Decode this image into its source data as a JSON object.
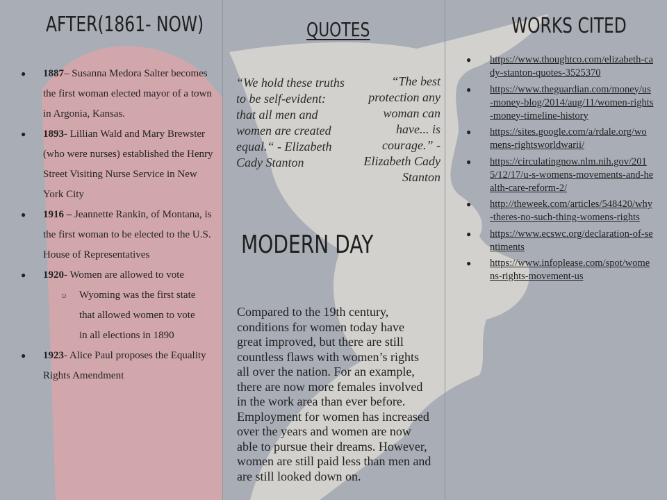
{
  "after": {
    "heading": "AFTER(1861- NOW)",
    "events": [
      {
        "year": "1887",
        "text": "– Susanna Medora Salter becomes the first woman elected mayor of a town in Argonia, Kansas."
      },
      {
        "year": "1893",
        "text": "- Lillian Wald and Mary Brewster (who were nurses) established the Henry Street Visiting Nurse Service in New York City"
      },
      {
        "year": "1916 –",
        "text": " Jeannette Rankin, of Montana, is the first woman to be elected to the U.S. House of Representatives"
      },
      {
        "year": "1920",
        "text": "- Women are allowed to vote"
      },
      {
        "year": "1923",
        "text": "- Alice Paul proposes the Equality Rights Amendment"
      }
    ],
    "subevent": "Wyoming was the first state that allowed women to vote in all elections in 1890"
  },
  "quotes": {
    "heading": "QUOTES",
    "quote1": "“We hold these truths to be self-evident: that all men and women are created equal.“ - Elizabeth Cady Stanton",
    "quote2": "“The best protection any woman can have... is courage.” -Elizabeth Cady Stanton"
  },
  "modern": {
    "heading": "MODERN DAY",
    "text": "Compared to the 19th century, conditions for women today have great improved, but there are still countless flaws with women’s rights all over the nation. For an example, there are now more females involved in the work area than ever before. Employment for women has increased over the years and women are now able to pursue their dreams. However, women are still paid less than men and are still looked down on."
  },
  "works": {
    "heading": "WORKS CITED",
    "links": [
      "https://www.thoughtco.com/elizabeth-cady-stanton-quotes-3525370",
      "https://www.theguardian.com/money/us-money-blog/2014/aug/11/women-rights-money-timeline-history",
      "https://sites.google.com/a/rdale.org/womens-rightsworldwarii/",
      "https://circulatingnow.nlm.nih.gov/2015/12/17/u-s-womens-movements-and-health-care-reform-2/",
      "http://theweek.com/articles/548420/why-theres-no-such-thing-womens-rights",
      "https://www.ecswc.org/declaration-of-sentiments",
      "https://www.infoplease.com/spot/womens-rights-movement-us"
    ]
  },
  "colors": {
    "background": "#a9aeb6",
    "flag_red": "#d9a6a9",
    "silhouette": "#d6d5cf"
  }
}
